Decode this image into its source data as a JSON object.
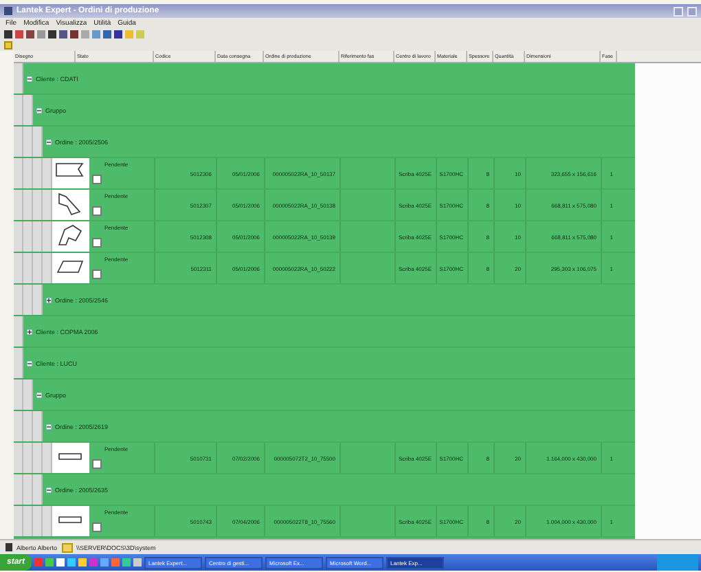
{
  "window": {
    "title": "Lantek Expert - Ordini di produzione"
  },
  "menu": [
    "File",
    "Modifica",
    "Visualizza",
    "Utilità",
    "Guida"
  ],
  "columns": [
    "Disegno",
    "Stato",
    "Codice",
    "Data consegna",
    "Ordine di produzione",
    "Riferimento fas",
    "Centro di lavoro",
    "Materiale",
    "Spessore",
    "Quantità",
    "Dimensioni",
    "Fase"
  ],
  "tree": [
    {
      "kind": "group",
      "label": "Cliente : CDATI",
      "expanded": true,
      "children": [
        {
          "kind": "group",
          "label": "Gruppo",
          "expanded": true,
          "children": [
            {
              "kind": "group",
              "label": "Ordine : 2005/2506",
              "expanded": true,
              "children": [
                {
                  "kind": "item",
                  "status": "Pendente",
                  "code": "5012306",
                  "date": "05/01/2006",
                  "order": "000005022RA_10_50137",
                  "center": "Scriba 4025E",
                  "material": "S1700HC",
                  "thickness": "8",
                  "quantity": "10",
                  "dimensions": "323,655 x 156,616",
                  "phase": "1"
                },
                {
                  "kind": "item",
                  "status": "Pendente",
                  "code": "5012307",
                  "date": "05/01/2006",
                  "order": "000005022RA_10_50138",
                  "center": "Scriba 4025E",
                  "material": "S1700HC",
                  "thickness": "8",
                  "quantity": "10",
                  "dimensions": "668,811 x 575,080",
                  "phase": "1"
                },
                {
                  "kind": "item",
                  "status": "Pendente",
                  "code": "5012308",
                  "date": "05/01/2006",
                  "order": "000005022RA_10_50139",
                  "center": "Scriba 4025E",
                  "material": "S1700HC",
                  "thickness": "8",
                  "quantity": "10",
                  "dimensions": "668,811 x 575,080",
                  "phase": "1"
                },
                {
                  "kind": "item",
                  "status": "Pendente",
                  "code": "5012311",
                  "date": "05/01/2006",
                  "order": "000005022RA_10_50222",
                  "center": "Scriba 4025E",
                  "material": "S1700HC",
                  "thickness": "8",
                  "quantity": "20",
                  "dimensions": "295,303 x 106,075",
                  "phase": "1"
                }
              ]
            },
            {
              "kind": "group",
              "label": "Ordine : 2005/2546",
              "expanded": false
            }
          ]
        }
      ]
    },
    {
      "kind": "group",
      "label": "Cliente : COPMA 2006",
      "expanded": false
    },
    {
      "kind": "group",
      "label": "Cliente : LUCU",
      "expanded": true,
      "children": [
        {
          "kind": "group",
          "label": "Gruppo",
          "expanded": true,
          "children": [
            {
              "kind": "group",
              "label": "Ordine : 2005/2619",
              "expanded": true,
              "children": [
                {
                  "kind": "item",
                  "status": "Pendente",
                  "code": "5010731",
                  "date": "07/02/2006",
                  "order": "000005072T2_10_75500",
                  "center": "Scriba 4025E",
                  "material": "S1700HC",
                  "thickness": "8",
                  "quantity": "20",
                  "dimensions": "1.164,000 x 430,000",
                  "phase": "1"
                }
              ]
            },
            {
              "kind": "group",
              "label": "Ordine : 2005/2635",
              "expanded": true,
              "children": [
                {
                  "kind": "item",
                  "status": "Pendente",
                  "code": "5010743",
                  "date": "07/04/2006",
                  "order": "000005022T8_10_75560",
                  "center": "Scriba 4025E",
                  "material": "S1700HC",
                  "thickness": "8",
                  "quantity": "20",
                  "dimensions": "1.004,000 x 430,000",
                  "phase": "1"
                }
              ]
            }
          ]
        }
      ]
    }
  ],
  "status_bar": {
    "user": "Alberto Alberto",
    "path": "\\\\SERVER\\DOCS\\3D\\system"
  },
  "taskbar": {
    "start": "start",
    "tasks": [
      {
        "label": "Lantek Expert...",
        "selected": false
      },
      {
        "label": "Centro di gesti...",
        "selected": false
      },
      {
        "label": "Microsoft Ex...",
        "selected": false
      },
      {
        "label": "Microsoft Word...",
        "selected": false
      },
      {
        "label": "Lantek Exp...",
        "selected": true
      }
    ]
  }
}
